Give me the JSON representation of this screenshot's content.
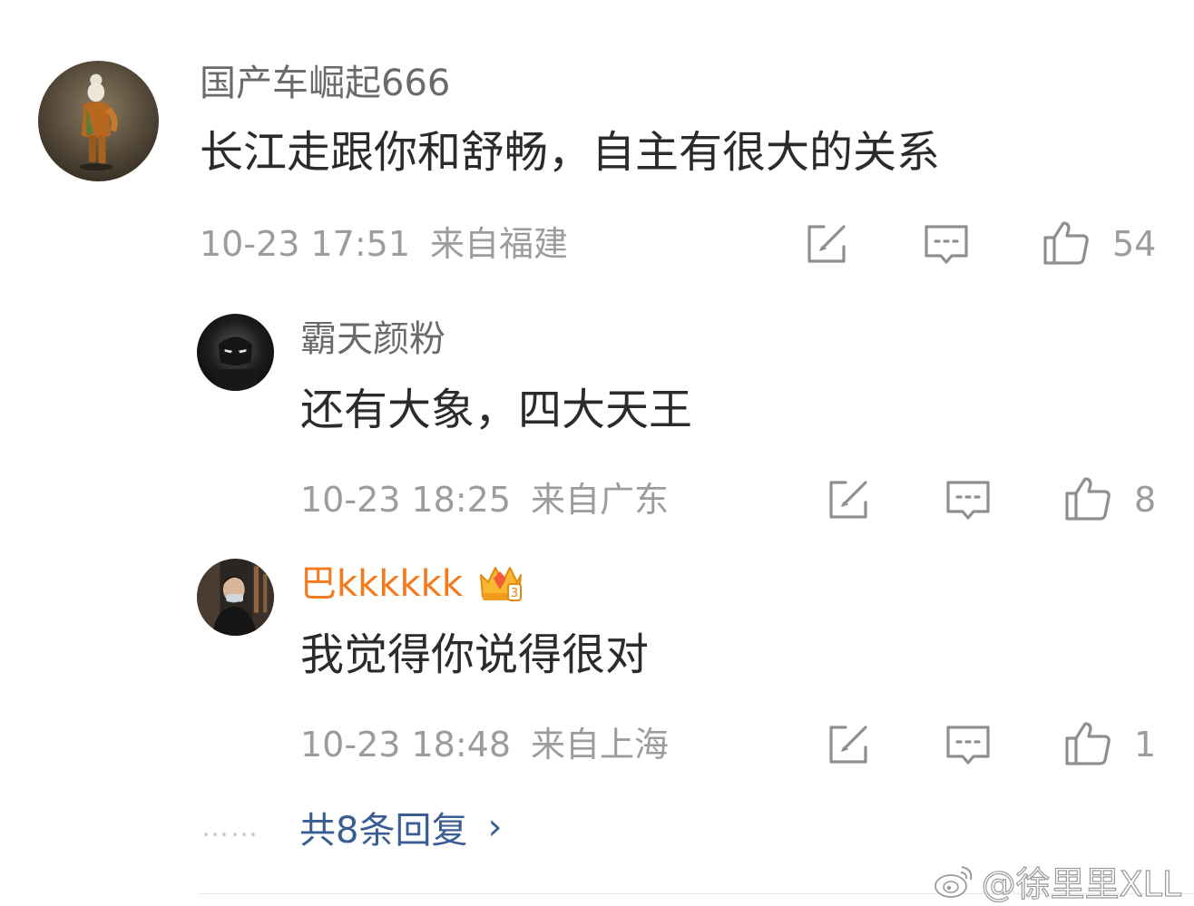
{
  "comments": [
    {
      "username": "国产车崛起666",
      "content": "长江走跟你和舒畅，自主有很大的关系",
      "time": "10-23 17:51",
      "location": "来自福建",
      "likes": "54"
    },
    {
      "username": "霸天颜粉",
      "content": "还有大象，四大天王",
      "time": "10-23 18:25",
      "location": "来自广东",
      "likes": "8"
    },
    {
      "username": "巴kkkkkk",
      "vip_level": "3",
      "content": "我觉得你说得很对",
      "time": "10-23 18:48",
      "location": "来自上海",
      "likes": "1"
    }
  ],
  "more_replies": {
    "dots": "……",
    "label": "共8条回复",
    "chevron": "›"
  },
  "watermark": {
    "text": "@徐里里XLL",
    "icon": "weibo-logo-icon"
  },
  "colors": {
    "username": "#6a6a6a",
    "vip_username": "#f47a1d",
    "content": "#2b2b2b",
    "meta": "#9c9c9c",
    "link": "#3a5d93"
  },
  "icons": {
    "repost": "repost-icon",
    "comment": "comment-icon",
    "like": "thumbs-up-icon",
    "vip": "crown-icon"
  }
}
